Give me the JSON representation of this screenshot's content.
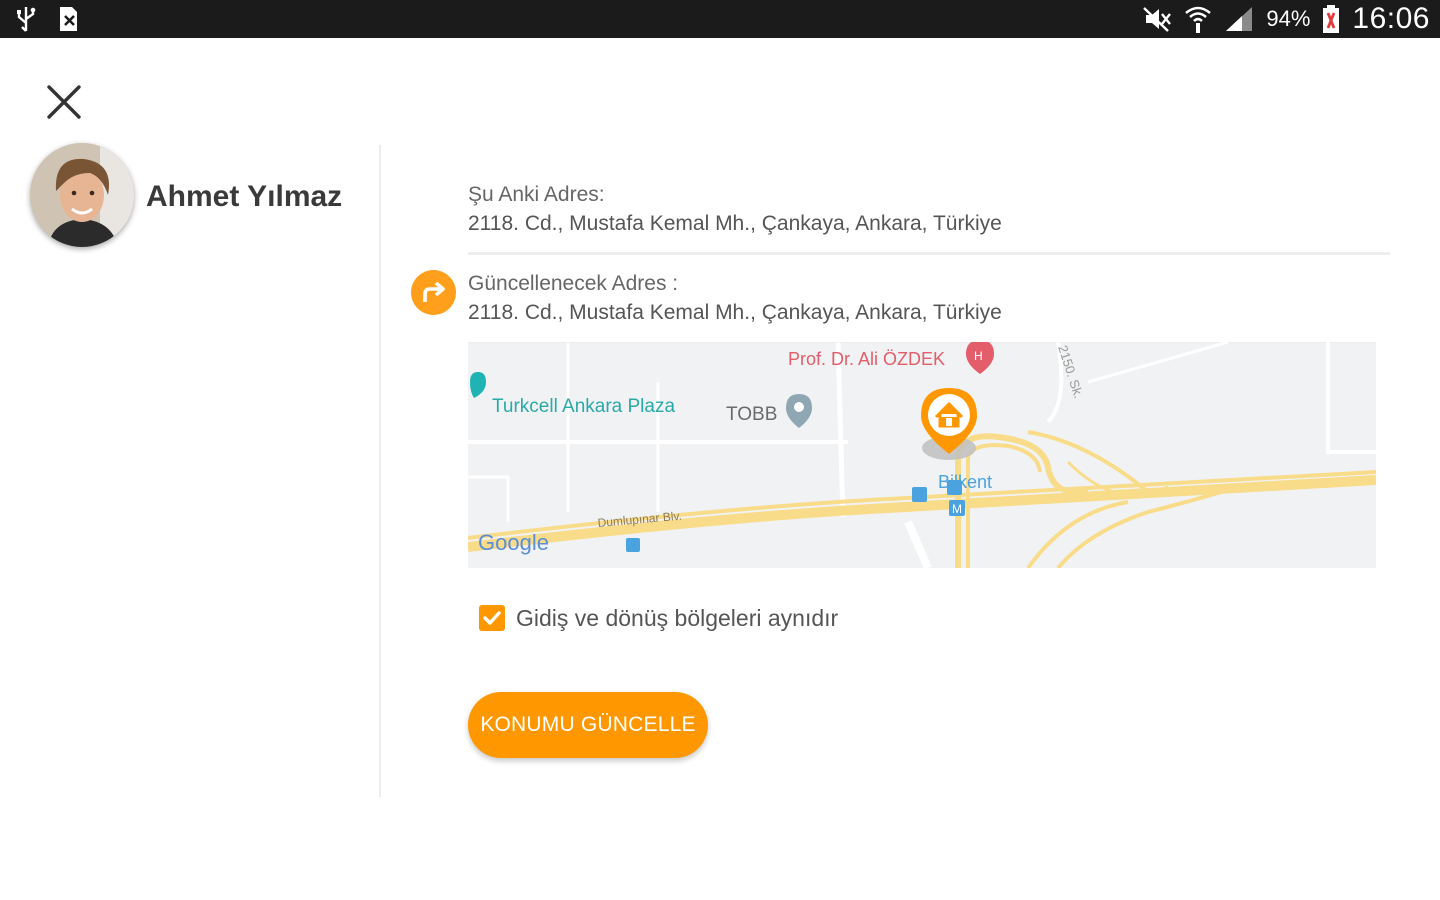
{
  "status_bar": {
    "battery": "94%",
    "time": "16:06"
  },
  "user": {
    "name": "Ahmet Yılmaz"
  },
  "current_address": {
    "label": "Şu Anki Adres:",
    "value": "2118. Cd., Mustafa Kemal Mh., Çankaya, Ankara, Türkiye"
  },
  "new_address": {
    "label": "Güncellenecek Adres :",
    "value": "2118. Cd., Mustafa Kemal Mh., Çankaya, Ankara, Türkiye"
  },
  "map": {
    "labels": {
      "turkcell": "Turkcell Ankara Plaza",
      "tobb": "TOBB",
      "prof": "Prof. Dr. Ali ÖZDEK",
      "bilkent": "Bilkent",
      "street_2150": "2150. Sk.",
      "dumlupinar": "Dumlupınar Blv.",
      "google": "Google"
    },
    "colors": {
      "road": "#f9dc8a",
      "pin": "#ff9800",
      "transit": "#4aa3df",
      "poi_red": "#e35d6a"
    }
  },
  "same_regions": {
    "label": "Gidiş ve dönüş bölgeleri aynıdır",
    "checked": true
  },
  "update_button": {
    "label": "KONUMU GÜNCELLE"
  },
  "colors": {
    "accent": "#ff9800",
    "status_bar": "#1b1b1b"
  }
}
